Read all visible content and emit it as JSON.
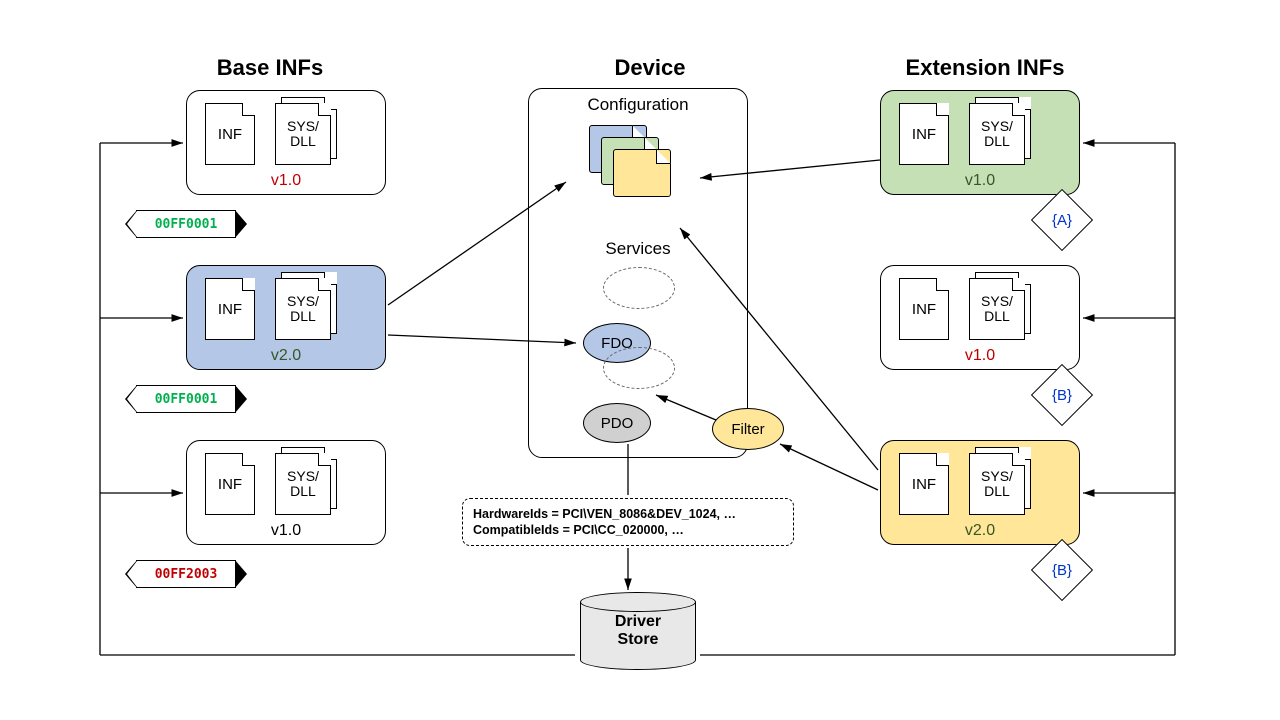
{
  "titles": {
    "base": "Base INFs",
    "device": "Device",
    "ext": "Extension INFs"
  },
  "labels": {
    "inf": "INF",
    "sysdll": "SYS/\nDLL",
    "config": "Configuration",
    "services": "Services",
    "fdo": "FDO",
    "pdo": "PDO",
    "filter": "Filter",
    "driverstore1": "Driver",
    "driverstore2": "Store"
  },
  "base": [
    {
      "version": "v1.0",
      "vclass": "red",
      "banner": "00FF0001",
      "bclass": "green-txt",
      "fill": ""
    },
    {
      "version": "v2.0",
      "vclass": "green",
      "banner": "00FF0001",
      "bclass": "green-txt",
      "fill": "blue"
    },
    {
      "version": "v1.0",
      "vclass": "black",
      "banner": "00FF2003",
      "bclass": "red-txt",
      "fill": ""
    }
  ],
  "ext": [
    {
      "version": "v1.0",
      "vclass": "green",
      "diamond": "{A}",
      "fill": "green"
    },
    {
      "version": "v1.0",
      "vclass": "red",
      "diamond": "{B}",
      "fill": ""
    },
    {
      "version": "v2.0",
      "vclass": "green",
      "diamond": "{B}",
      "fill": "gold"
    }
  ],
  "ids": {
    "hw": "HardwareIds = PCI\\VEN_8086&DEV_1024, …",
    "compat": "CompatibleIds = PCI\\CC_020000, …"
  }
}
